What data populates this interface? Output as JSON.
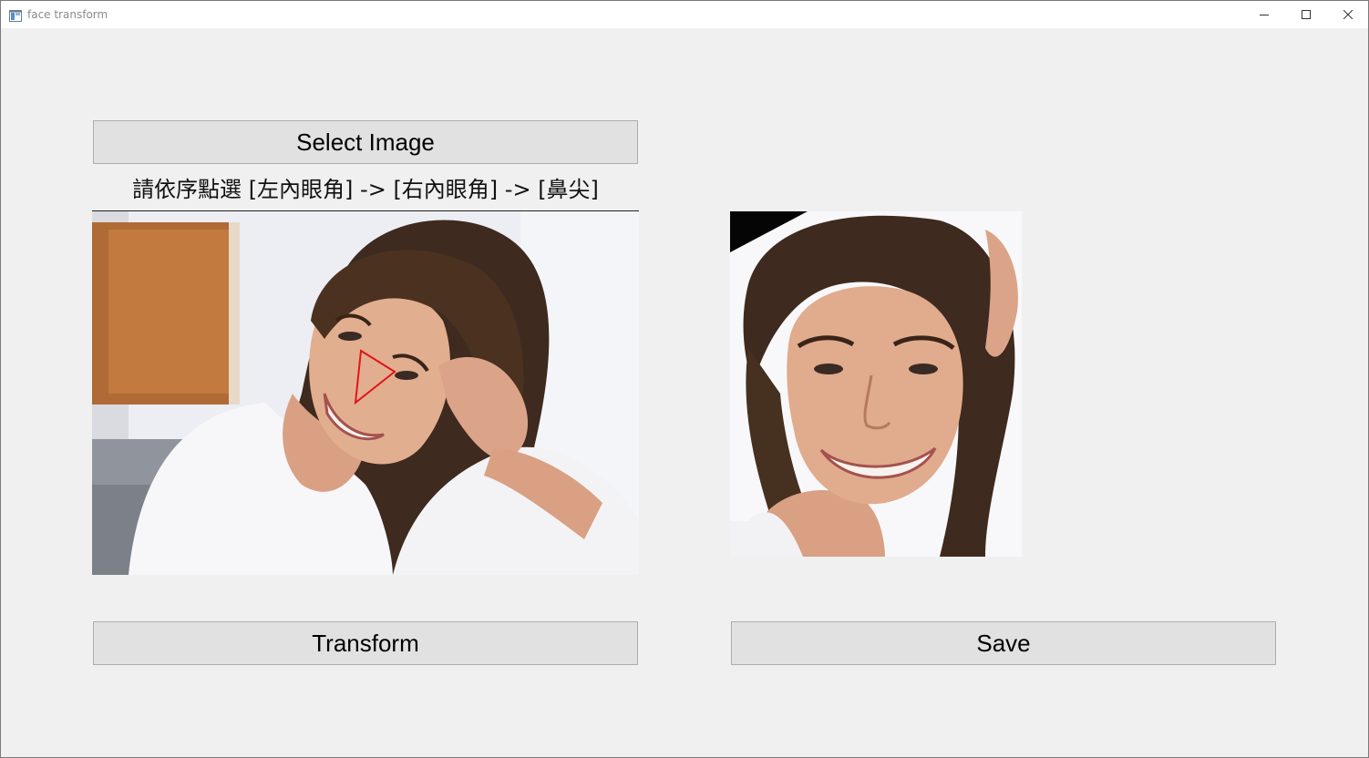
{
  "window": {
    "title": "face transform",
    "controls": {
      "minimize": "minimize-icon",
      "maximize": "maximize-icon",
      "close": "close-icon"
    }
  },
  "buttons": {
    "select_label": "Select Image",
    "transform_label": "Transform",
    "save_label": "Save"
  },
  "instruction": "請依序點選 [左內眼角] -> [右內眼角] -> [鼻尖]",
  "colors": {
    "window_bg": "#f0f0f0",
    "button_bg": "#e1e1e1",
    "button_border": "#adadad",
    "marker": "#e0151b"
  }
}
